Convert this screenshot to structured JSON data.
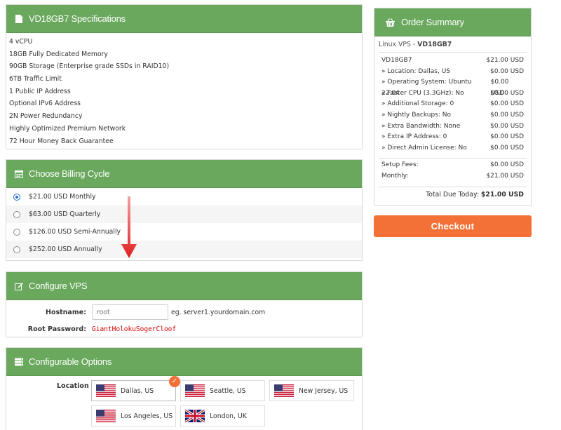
{
  "spec": {
    "title": "VD18GB7 Specifications",
    "items": [
      "4 vCPU",
      "18GB Fully Dedicated Memory",
      "90GB Storage (Enterprise grade SSDs in RAID10)",
      "6TB Traffic Limit",
      "1 Public IP Address",
      "Optional IPv6 Address",
      "2N Power Redundancy",
      "Highly Optimized Premium Network",
      "72 Hour Money Back Guarantee"
    ]
  },
  "billing": {
    "title": "Choose Billing Cycle",
    "options": [
      {
        "label": "$21.00 USD Monthly",
        "selected": true
      },
      {
        "label": "$63.00 USD Quarterly",
        "selected": false
      },
      {
        "label": "$126.00 USD Semi-Annually",
        "selected": false
      },
      {
        "label": "$252.00 USD Annually",
        "selected": false
      }
    ]
  },
  "config": {
    "title": "Configure VPS",
    "hostname_label": "Hostname:",
    "hostname_placeholder": "root",
    "hostname_hint": "eg. server1.yourdomain.com",
    "password_label": "Root Password:",
    "password_value": "GiantHolokuSogerCloof"
  },
  "options": {
    "title": "Configurable Options",
    "location_label": "Location",
    "locations": [
      {
        "name": "Dallas, US",
        "flag": "us",
        "selected": true
      },
      {
        "name": "Seattle, US",
        "flag": "us",
        "selected": false
      },
      {
        "name": "New Jersey, US",
        "flag": "us",
        "selected": false
      },
      {
        "name": "Los Angeles, US",
        "flag": "us",
        "selected": false
      },
      {
        "name": "London, UK",
        "flag": "uk",
        "selected": false
      }
    ],
    "check_mark": "✓"
  },
  "summary": {
    "title": "Order Summary",
    "product_group": "Linux VPS",
    "product_sep": " - ",
    "product_name": "VD18GB7",
    "lines": [
      {
        "label": "VD18GB7",
        "value": "$21.00 USD"
      },
      {
        "label": "» Location: Dallas, US",
        "value": "$0.00 USD"
      },
      {
        "label": "» Operating System: Ubuntu 22.04",
        "value": "$0.00 USD"
      },
      {
        "label": "» Faster CPU (3.3GHz): No",
        "value": "$0.00 USD"
      },
      {
        "label": "» Additional Storage: 0",
        "value": "$0.00 USD"
      },
      {
        "label": "» Nightly Backups: No",
        "value": "$0.00 USD"
      },
      {
        "label": "» Extra Bandwidth: None",
        "value": "$0.00 USD"
      },
      {
        "label": "» Extra IP Address: 0",
        "value": "$0.00 USD"
      },
      {
        "label": "» Direct Admin License: No",
        "value": "$0.00 USD"
      }
    ],
    "setup_label": "Setup Fees:",
    "setup_value": "$0.00 USD",
    "monthly_label": "Monthly:",
    "monthly_value": "$21.00 USD",
    "total_label": "Total Due Today:",
    "total_value": "$21.00 USD"
  },
  "checkout_label": "Checkout",
  "colors": {
    "header_green": "#6aa85e",
    "checkout_orange": "#f37036",
    "password_red": "#d10000",
    "annotation_arrow": "#e02020"
  }
}
